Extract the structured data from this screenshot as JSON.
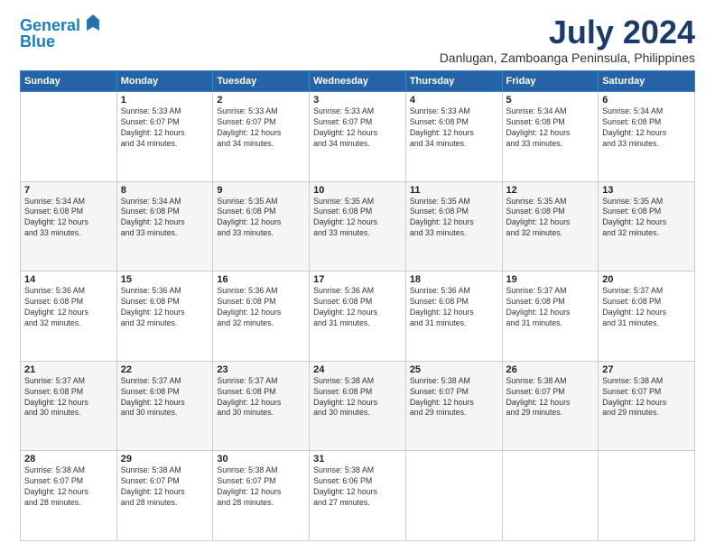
{
  "header": {
    "logo_line1": "General",
    "logo_line2": "Blue",
    "month_year": "July 2024",
    "location": "Danlugan, Zamboanga Peninsula, Philippines"
  },
  "days_of_week": [
    "Sunday",
    "Monday",
    "Tuesday",
    "Wednesday",
    "Thursday",
    "Friday",
    "Saturday"
  ],
  "weeks": [
    [
      {
        "day": "",
        "info": ""
      },
      {
        "day": "1",
        "info": "Sunrise: 5:33 AM\nSunset: 6:07 PM\nDaylight: 12 hours\nand 34 minutes."
      },
      {
        "day": "2",
        "info": "Sunrise: 5:33 AM\nSunset: 6:07 PM\nDaylight: 12 hours\nand 34 minutes."
      },
      {
        "day": "3",
        "info": "Sunrise: 5:33 AM\nSunset: 6:07 PM\nDaylight: 12 hours\nand 34 minutes."
      },
      {
        "day": "4",
        "info": "Sunrise: 5:33 AM\nSunset: 6:08 PM\nDaylight: 12 hours\nand 34 minutes."
      },
      {
        "day": "5",
        "info": "Sunrise: 5:34 AM\nSunset: 6:08 PM\nDaylight: 12 hours\nand 33 minutes."
      },
      {
        "day": "6",
        "info": "Sunrise: 5:34 AM\nSunset: 6:08 PM\nDaylight: 12 hours\nand 33 minutes."
      }
    ],
    [
      {
        "day": "7",
        "info": "Sunrise: 5:34 AM\nSunset: 6:08 PM\nDaylight: 12 hours\nand 33 minutes."
      },
      {
        "day": "8",
        "info": "Sunrise: 5:34 AM\nSunset: 6:08 PM\nDaylight: 12 hours\nand 33 minutes."
      },
      {
        "day": "9",
        "info": "Sunrise: 5:35 AM\nSunset: 6:08 PM\nDaylight: 12 hours\nand 33 minutes."
      },
      {
        "day": "10",
        "info": "Sunrise: 5:35 AM\nSunset: 6:08 PM\nDaylight: 12 hours\nand 33 minutes."
      },
      {
        "day": "11",
        "info": "Sunrise: 5:35 AM\nSunset: 6:08 PM\nDaylight: 12 hours\nand 33 minutes."
      },
      {
        "day": "12",
        "info": "Sunrise: 5:35 AM\nSunset: 6:08 PM\nDaylight: 12 hours\nand 32 minutes."
      },
      {
        "day": "13",
        "info": "Sunrise: 5:35 AM\nSunset: 6:08 PM\nDaylight: 12 hours\nand 32 minutes."
      }
    ],
    [
      {
        "day": "14",
        "info": "Sunrise: 5:36 AM\nSunset: 6:08 PM\nDaylight: 12 hours\nand 32 minutes."
      },
      {
        "day": "15",
        "info": "Sunrise: 5:36 AM\nSunset: 6:08 PM\nDaylight: 12 hours\nand 32 minutes."
      },
      {
        "day": "16",
        "info": "Sunrise: 5:36 AM\nSunset: 6:08 PM\nDaylight: 12 hours\nand 32 minutes."
      },
      {
        "day": "17",
        "info": "Sunrise: 5:36 AM\nSunset: 6:08 PM\nDaylight: 12 hours\nand 31 minutes."
      },
      {
        "day": "18",
        "info": "Sunrise: 5:36 AM\nSunset: 6:08 PM\nDaylight: 12 hours\nand 31 minutes."
      },
      {
        "day": "19",
        "info": "Sunrise: 5:37 AM\nSunset: 6:08 PM\nDaylight: 12 hours\nand 31 minutes."
      },
      {
        "day": "20",
        "info": "Sunrise: 5:37 AM\nSunset: 6:08 PM\nDaylight: 12 hours\nand 31 minutes."
      }
    ],
    [
      {
        "day": "21",
        "info": "Sunrise: 5:37 AM\nSunset: 6:08 PM\nDaylight: 12 hours\nand 30 minutes."
      },
      {
        "day": "22",
        "info": "Sunrise: 5:37 AM\nSunset: 6:08 PM\nDaylight: 12 hours\nand 30 minutes."
      },
      {
        "day": "23",
        "info": "Sunrise: 5:37 AM\nSunset: 6:08 PM\nDaylight: 12 hours\nand 30 minutes."
      },
      {
        "day": "24",
        "info": "Sunrise: 5:38 AM\nSunset: 6:08 PM\nDaylight: 12 hours\nand 30 minutes."
      },
      {
        "day": "25",
        "info": "Sunrise: 5:38 AM\nSunset: 6:07 PM\nDaylight: 12 hours\nand 29 minutes."
      },
      {
        "day": "26",
        "info": "Sunrise: 5:38 AM\nSunset: 6:07 PM\nDaylight: 12 hours\nand 29 minutes."
      },
      {
        "day": "27",
        "info": "Sunrise: 5:38 AM\nSunset: 6:07 PM\nDaylight: 12 hours\nand 29 minutes."
      }
    ],
    [
      {
        "day": "28",
        "info": "Sunrise: 5:38 AM\nSunset: 6:07 PM\nDaylight: 12 hours\nand 28 minutes."
      },
      {
        "day": "29",
        "info": "Sunrise: 5:38 AM\nSunset: 6:07 PM\nDaylight: 12 hours\nand 28 minutes."
      },
      {
        "day": "30",
        "info": "Sunrise: 5:38 AM\nSunset: 6:07 PM\nDaylight: 12 hours\nand 28 minutes."
      },
      {
        "day": "31",
        "info": "Sunrise: 5:38 AM\nSunset: 6:06 PM\nDaylight: 12 hours\nand 27 minutes."
      },
      {
        "day": "",
        "info": ""
      },
      {
        "day": "",
        "info": ""
      },
      {
        "day": "",
        "info": ""
      }
    ]
  ]
}
